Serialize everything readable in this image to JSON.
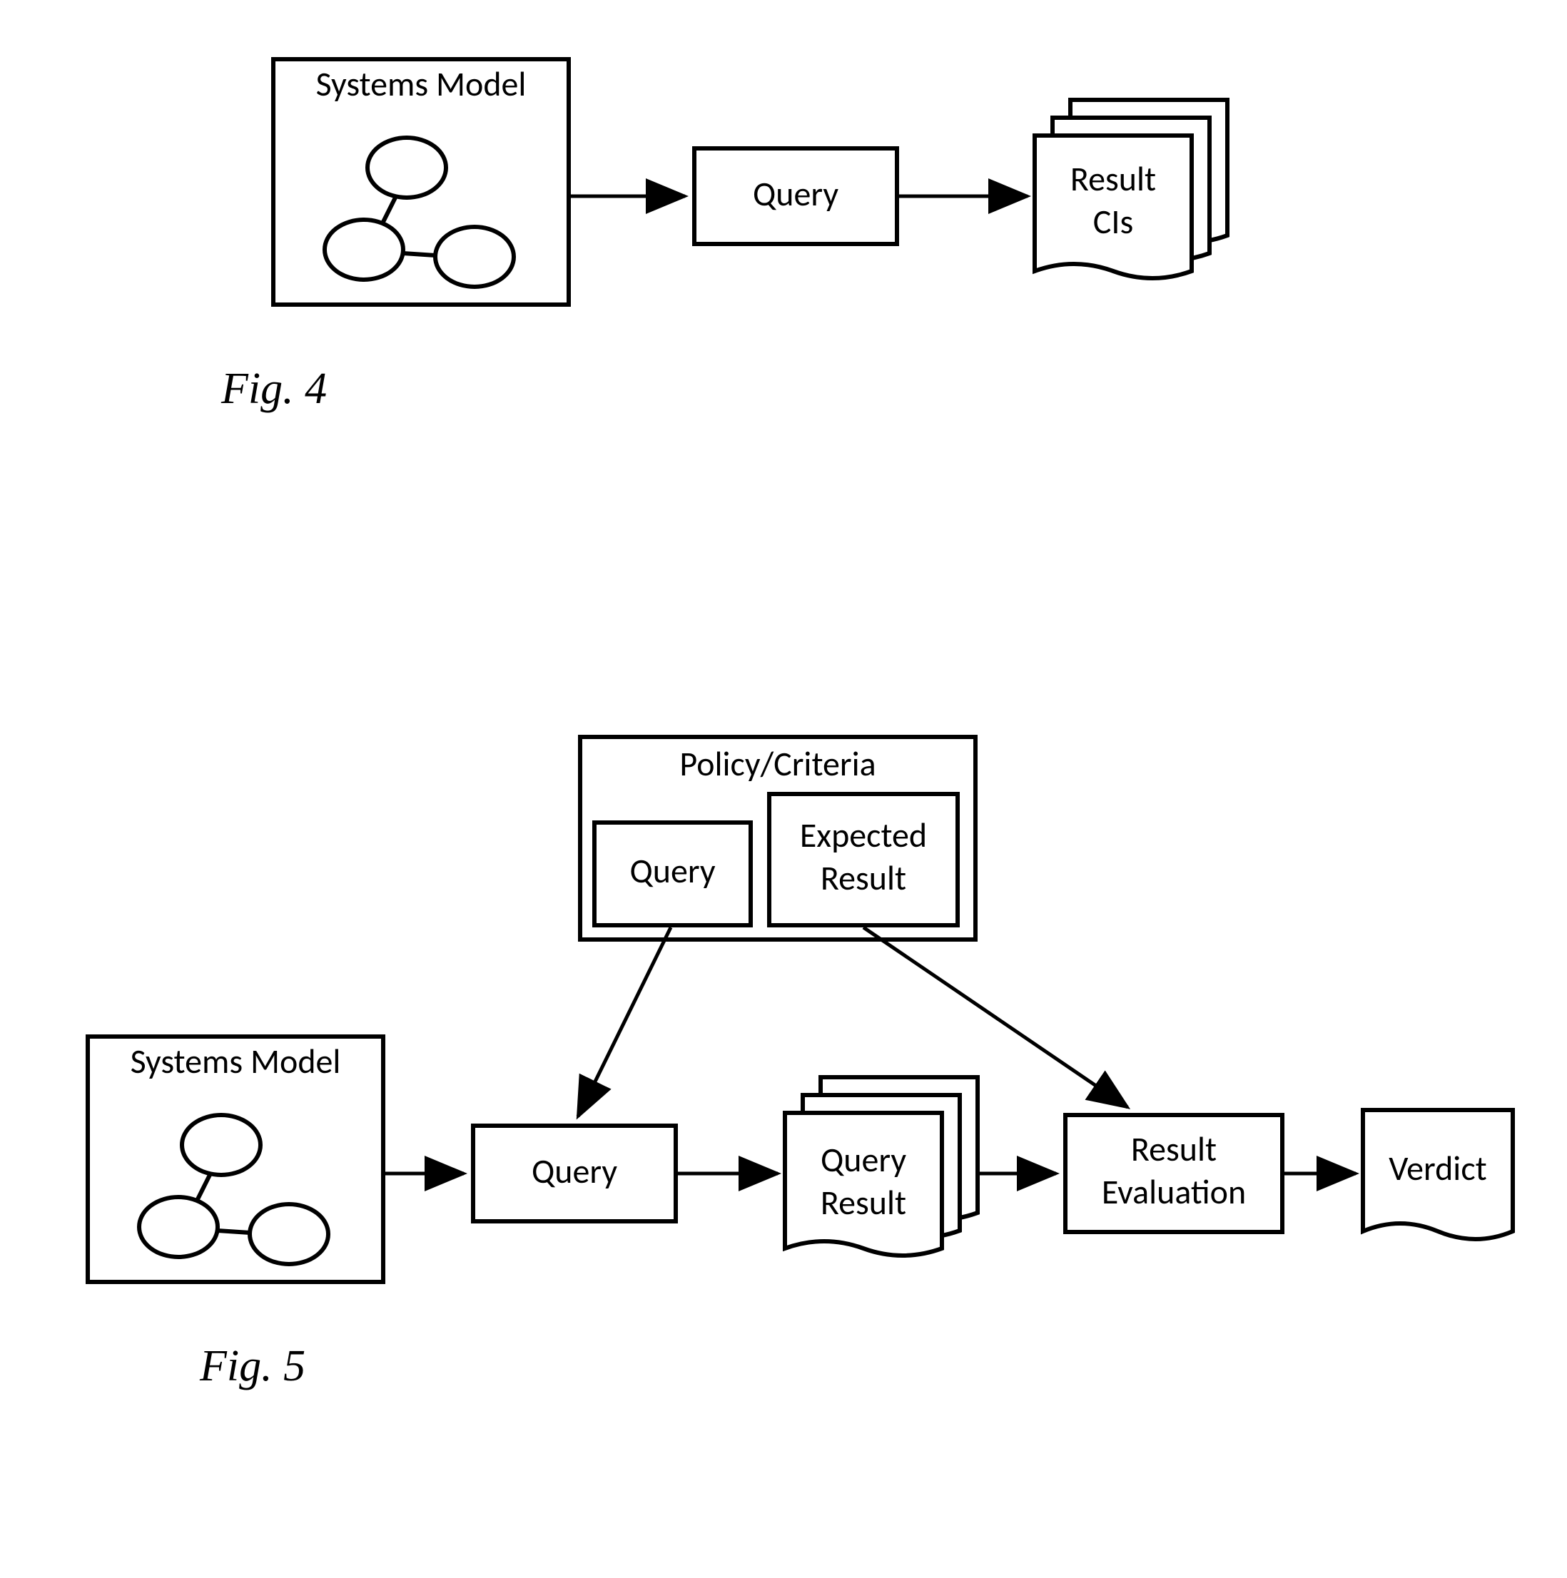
{
  "fig4": {
    "caption": "Fig. 4",
    "systems_model_title": "Systems Model",
    "query_label": "Query",
    "result_line1": "Result",
    "result_line2": "CIs"
  },
  "fig5": {
    "caption": "Fig. 5",
    "systems_model_title": "Systems Model",
    "policy_title": "Policy/Criteria",
    "policy_query": "Query",
    "policy_expected_line1": "Expected",
    "policy_expected_line2": "Result",
    "query_label": "Query",
    "query_result_line1": "Query",
    "query_result_line2": "Result",
    "result_eval_line1": "Result",
    "result_eval_line2": "Evaluation",
    "verdict": "Verdict"
  }
}
